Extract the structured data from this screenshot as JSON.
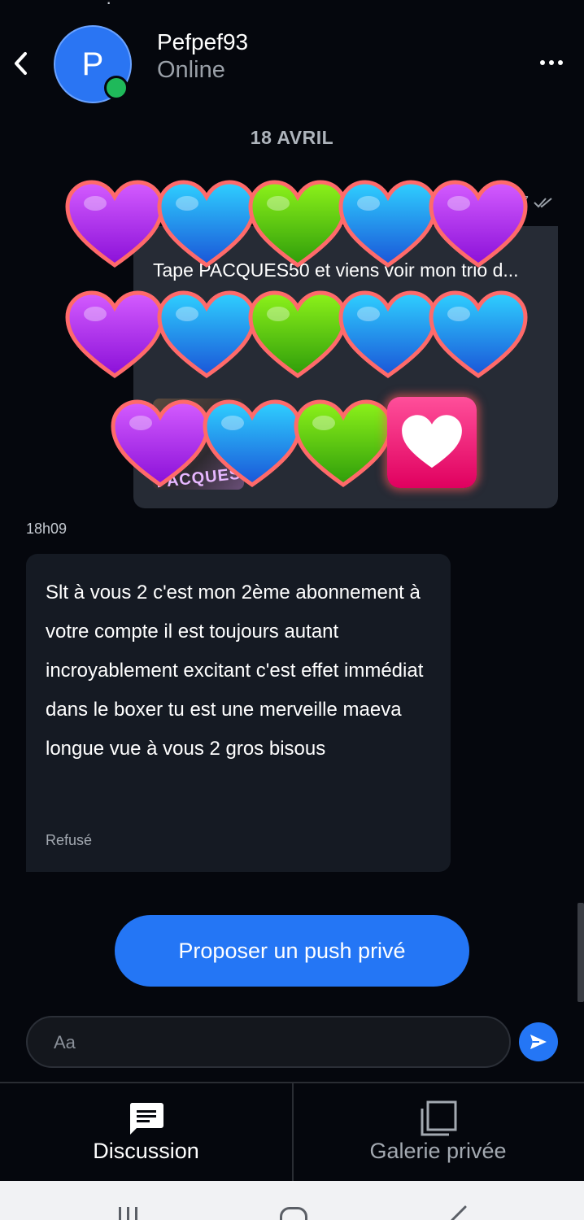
{
  "contact": {
    "avatar_letter": "P",
    "name": "Pefpef93",
    "presence": "Online"
  },
  "conversation": {
    "date_divider": "18 AVRIL",
    "outgoing": {
      "time": "07",
      "text": "Tape PACQUES50 et viens voir mon trio d... k...",
      "thumb_text": "PACQUES"
    },
    "incoming": {
      "time": "18h09",
      "text": "Slt à vous 2 c'est mon 2ème abonnement à votre compte il est toujours autant incroyablement excitant c'est effet immédiat dans le boxer tu est une merveille maeva longue vue à vous 2 gros bisous",
      "status": "Refusé"
    }
  },
  "actions": {
    "push_button": "Proposer un push privé"
  },
  "composer": {
    "placeholder": "Aa"
  },
  "tabs": [
    {
      "label": "Discussion",
      "icon": "chat-icon",
      "active": true
    },
    {
      "label": "Galerie privée",
      "icon": "gallery-icon",
      "active": false
    }
  ],
  "colors": {
    "background": "#05070d",
    "accent": "#2476f5",
    "online": "#1fb95a",
    "outgoing_bubble": "#262b35",
    "incoming_bubble": "#151a23"
  }
}
